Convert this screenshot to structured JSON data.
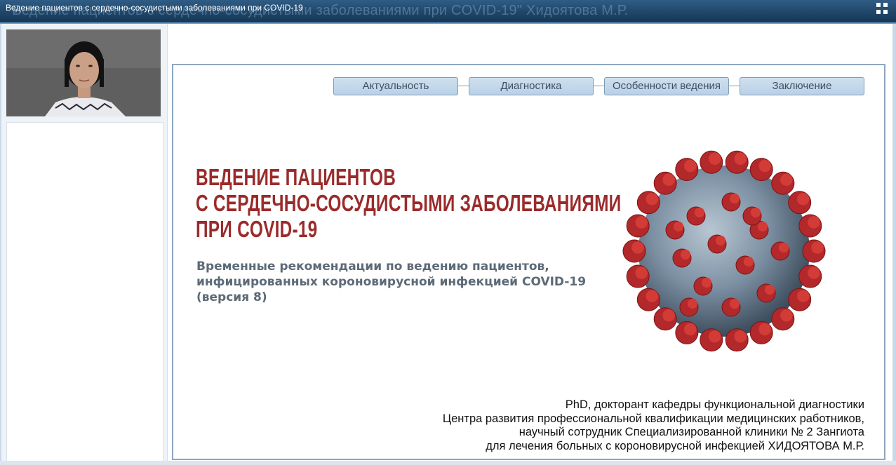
{
  "window": {
    "title": "Ведение пациентов с сердечно-сосудистыми заболеваниями при COVID-19",
    "ghost_title": "\"Ведение пациентов с сердечно-сосудистыми заболеваниями при COVID-19\" Хидоятова М.Р."
  },
  "slide": {
    "tabs": [
      "Актуальность",
      "Диагностика",
      "Особенности ведения",
      "Заключение"
    ],
    "heading_lines": [
      "ВЕДЕНИЕ ПАЦИЕНТОВ",
      "С СЕРДЕЧНО-СОСУДИСТЫМИ ЗАБОЛЕВАНИЯМИ",
      "ПРИ COVID-19"
    ],
    "subtitle_lines": [
      "Временные рекомендации по ведению пациентов,",
      "инфицированных короновирусной инфекцией COVID-19",
      "(версия 8)"
    ],
    "author_lines": [
      "PhD, докторант кафедры функциональной диагностики",
      "Центра развития профессиональной квалификации медицинских работников,",
      "научный сотрудник Специализированной клиники № 2 Зангиота",
      "для лечения больных с короновирусной инфекцией ХИДОЯТОВА М.Р."
    ]
  },
  "icons": {
    "fullscreen": "fullscreen-toggle-icon",
    "virus": "coronavirus-illustration"
  },
  "colors": {
    "heading": "#9b2b2b",
    "subtitle": "#5d6a77",
    "tab_fill": "#c4d8ea",
    "titlebar": "#1f4669"
  }
}
